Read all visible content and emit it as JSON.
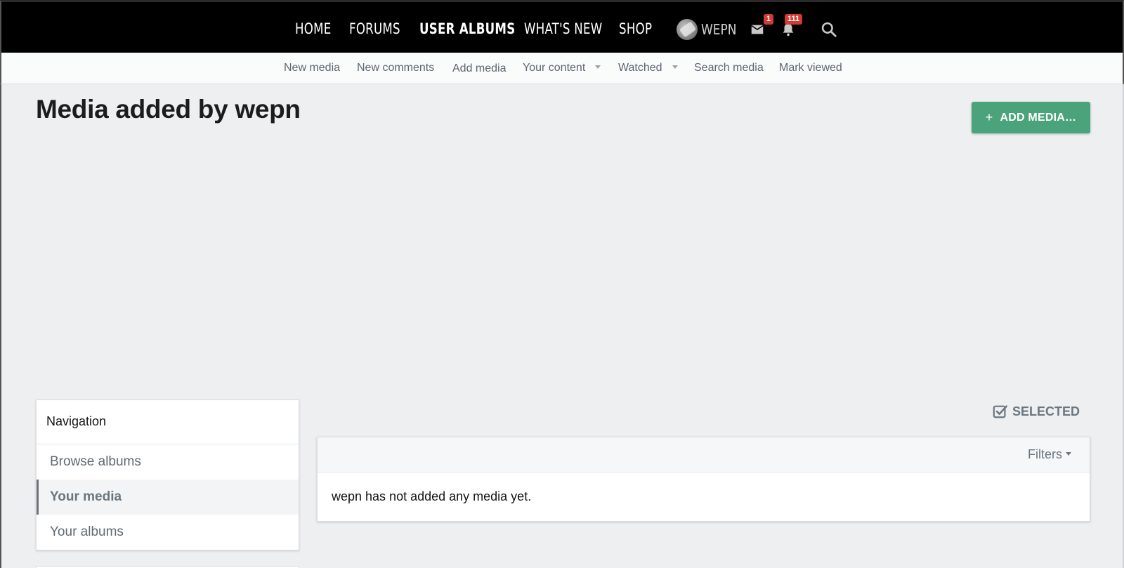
{
  "topnav": {
    "items": [
      {
        "label": "HOME"
      },
      {
        "label": "FORUMS"
      },
      {
        "label": "USER ALBUMS"
      },
      {
        "label": "WHAT'S NEW"
      },
      {
        "label": "SHOP"
      }
    ],
    "user": {
      "name": "WEPN"
    },
    "inbox_badge": "1",
    "alerts_badge": "111",
    "icons": [
      "envelope-icon",
      "bell-icon",
      "search-icon"
    ]
  },
  "subnav": {
    "items": [
      {
        "label": "New media"
      },
      {
        "label": "New comments"
      },
      {
        "label": "Add media"
      },
      {
        "label": "Your content"
      },
      {
        "label": "Watched"
      },
      {
        "label": "Search media"
      },
      {
        "label": "Mark viewed"
      }
    ]
  },
  "page": {
    "title": "Media added by wepn",
    "add_button": "ADD MEDIA…"
  },
  "sidebar": {
    "header": "Navigation",
    "items": [
      {
        "label": "Browse albums"
      },
      {
        "label": "Your media"
      },
      {
        "label": "Your albums"
      }
    ]
  },
  "main": {
    "selected_label": "SELECTED",
    "filters_label": "Filters",
    "empty_message": "wepn has not added any media yet."
  },
  "colors": {
    "topbar": "#000000",
    "accent_button": "#4aa37a",
    "badge": "#d23b33",
    "page_bg": "#eeeff1"
  }
}
